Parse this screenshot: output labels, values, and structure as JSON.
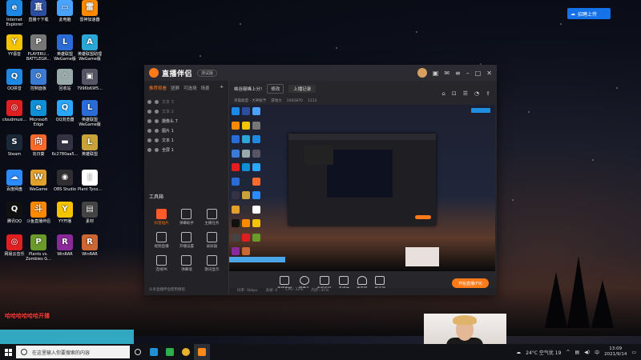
{
  "desktop_icons": [
    {
      "label": "Internet Explorer",
      "color": "#1e88e5",
      "glyph": "e"
    },
    {
      "label": "直播十下载",
      "color": "#2c4ea0",
      "glyph": "直"
    },
    {
      "label": "此电脑",
      "color": "#4aa3ff",
      "glyph": "▭"
    },
    {
      "label": "雷神加速器",
      "color": "#ff8a00",
      "glyph": "雷"
    },
    {
      "label": "YY语音",
      "color": "#f5c400",
      "glyph": "Y"
    },
    {
      "label": "PLAYERU... BATTLEGR...",
      "color": "#777",
      "glyph": "P"
    },
    {
      "label": "英雄联盟 WeGame版",
      "color": "#2a6bd6",
      "glyph": "L"
    },
    {
      "label": "英雄联盟助理 WeGame版",
      "color": "#2aa7d6",
      "glyph": "A"
    },
    {
      "label": "QQ拼音",
      "color": "#1e88e5",
      "glyph": "Q"
    },
    {
      "label": "控制面板",
      "color": "#3a7bd5",
      "glyph": "⚙"
    },
    {
      "label": "回收站",
      "color": "#9aa",
      "glyph": "♲"
    },
    {
      "label": "7996b69f5...",
      "color": "#556",
      "glyph": "▣"
    },
    {
      "label": "cloudmusi...",
      "color": "#e02020",
      "glyph": "◎"
    },
    {
      "label": "Microsoft Edge",
      "color": "#0f8fd6",
      "glyph": "e"
    },
    {
      "label": "QQ浏览器",
      "color": "#2aa7ff",
      "glyph": "Q"
    },
    {
      "label": "英雄联盟 WeGame版",
      "color": "#2a6bd6",
      "glyph": "L"
    },
    {
      "label": "Steam",
      "color": "#1b2838",
      "glyph": "S"
    },
    {
      "label": "向日葵",
      "color": "#ff6a2a",
      "glyph": "向"
    },
    {
      "label": "6c2780aa5...",
      "color": "#334",
      "glyph": "▬"
    },
    {
      "label": "英雄联盟",
      "color": "#c9a23a",
      "glyph": "L"
    },
    {
      "label": "百度网盘",
      "color": "#2a8cff",
      "glyph": "☁"
    },
    {
      "label": "WeGame",
      "color": "#e2a12b",
      "glyph": "W"
    },
    {
      "label": "OBS Studio",
      "color": "#302e31",
      "glyph": "◉"
    },
    {
      "label": "Plant Tyco...",
      "color": "#fff",
      "glyph": "▯"
    },
    {
      "label": "腾讯QQ",
      "color": "#111",
      "glyph": "Q"
    },
    {
      "label": "斗鱼直播伴侣",
      "color": "#ff8a00",
      "glyph": "斗"
    },
    {
      "label": "YY开播",
      "color": "#f5c400",
      "glyph": "Y"
    },
    {
      "label": "素材",
      "color": "#444",
      "glyph": "▤"
    },
    {
      "label": "网易云音乐",
      "color": "#e02020",
      "glyph": "◎"
    },
    {
      "label": "Plants vs. Zombies G...",
      "color": "#6a9a2a",
      "glyph": "P"
    },
    {
      "label": "WinRAR",
      "color": "#8a2a9a",
      "glyph": "R"
    },
    {
      "label": "WinRAR",
      "color": "#c63",
      "glyph": "R"
    }
  ],
  "top_widget": {
    "label": "招聘上传"
  },
  "app": {
    "name": "直播伴侣",
    "version": "测试版",
    "sidebar_tabs": [
      "推荐观看",
      "竖屏",
      "可选场",
      "场景"
    ],
    "scenes": [
      {
        "label": "文本 3",
        "dim": true
      },
      {
        "label": "文本 2",
        "dim": true
      },
      {
        "label": "摄像头 7",
        "dim": false
      },
      {
        "label": "图片 1",
        "dim": false
      },
      {
        "label": "文本 1",
        "dim": false
      },
      {
        "label": "全屏 1",
        "dim": false
      }
    ],
    "tools_title": "工具箱",
    "tools": [
      {
        "label": "抖音短片",
        "hot": true
      },
      {
        "label": "弹幕助手",
        "hot": false
      },
      {
        "label": "主播任务",
        "hot": false
      },
      {
        "label": "视频直播",
        "hot": false
      },
      {
        "label": "开播设置",
        "hot": false
      },
      {
        "label": "录屏器",
        "hot": false
      },
      {
        "label": "连线PK",
        "hot": false
      },
      {
        "label": "弹幕墙",
        "hot": false
      },
      {
        "label": "歌词显示",
        "hot": false
      }
    ],
    "side_footer": "头条直播伴侣使用教程",
    "room_title": "峡谷巅峰上分!",
    "room_tag": "修改",
    "room_edit": "上播记录",
    "room_meta": [
      "英雄联盟 · 大神赋予",
      "游戏大",
      "1002870",
      "1113"
    ],
    "controls": [
      "直播素材",
      "摄像头",
      "手机投屏",
      "多媒体",
      "麦克风",
      "扬声器"
    ],
    "go_live": "开始直播(F9)",
    "status": [
      "码率: 0kbps",
      "丢帧: 0",
      "CPU: 32%",
      "内存: 41%"
    ]
  },
  "overlay_left_text": "哈哈哈哈哈哈开播",
  "taskbar": {
    "search_placeholder": "在这里输入你要搜索的内容",
    "weather": "24°C 空气优 19",
    "time": "13:09",
    "date": "2021/9/14"
  }
}
